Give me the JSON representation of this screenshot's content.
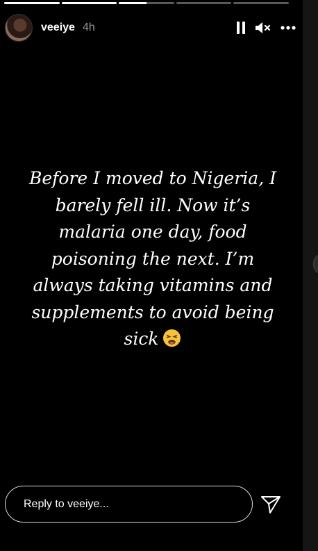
{
  "story": {
    "progress": [
      1,
      1,
      0.5,
      0,
      0
    ],
    "username": "veeiye",
    "time": "4h",
    "text_lines": [
      "Before I moved to Nigeria, I",
      "barely fell ill. Now it’s",
      "malaria one day, food",
      "poisoning the next. I’m",
      "always taking vitamins and",
      "supplements to avoid being",
      "sick"
    ],
    "emoji": "weary-face-emoji"
  },
  "controls": {
    "pause_icon": "pause-icon",
    "mute_icon": "mute-icon",
    "more_icon": "more-icon"
  },
  "reply": {
    "placeholder": "Reply to veeiye..."
  },
  "colors": {
    "background": "#000000",
    "text": "#ffffff",
    "secondary_text": "#9a9a9a",
    "reply_border": "#dcdcdc"
  }
}
